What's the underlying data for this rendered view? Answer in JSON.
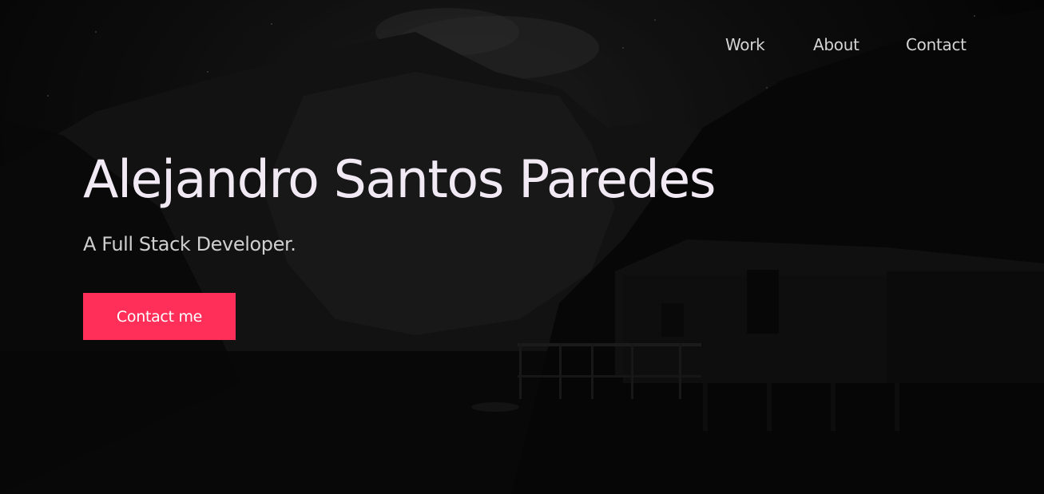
{
  "nav": {
    "items": [
      {
        "label": "Work"
      },
      {
        "label": "About"
      },
      {
        "label": "Contact"
      }
    ]
  },
  "hero": {
    "name": "Alejandro Santos Paredes",
    "subtitle": "A Full Stack Developer.",
    "cta_label": "Contact me",
    "background_image": "night-mountain-lake-cabin"
  },
  "colors": {
    "background": "#070707",
    "heading": "#f1e9f4",
    "subtitle": "#cfcfcf",
    "nav": "#d4d4d4",
    "accent": "#ff2f5a"
  }
}
